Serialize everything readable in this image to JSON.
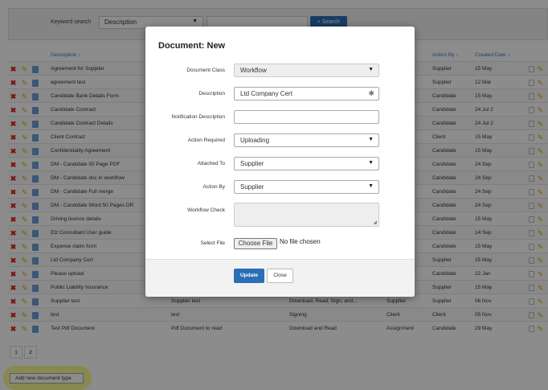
{
  "search": {
    "label": "Keyword search",
    "field_value": "Description",
    "button_label": "Search",
    "button_icon": "search-icon"
  },
  "table": {
    "headers": {
      "description": "Description ↕",
      "action_by": "Action By ↕",
      "created_date": "Created Date ↕"
    },
    "rows": [
      {
        "description": "Agreement for Supplier",
        "action_by": "Supplier",
        "created": "15 May"
      },
      {
        "description": "agreement test",
        "action_by": "Supplier",
        "created": "12 Mar"
      },
      {
        "description": "Candidate Bank Details Form",
        "action_by": "Candidate",
        "created": "15 May"
      },
      {
        "description": "Candidate Contract",
        "action_by": "Candidate",
        "created": "24 Jul 2"
      },
      {
        "description": "Candidate Contract Details",
        "action_by": "Candidate",
        "created": "24 Jul 2"
      },
      {
        "description": "Client Contract",
        "action_by": "Client",
        "created": "15 May"
      },
      {
        "description": "Confidentiality Agreement",
        "action_by": "Candidate",
        "created": "15 May"
      },
      {
        "description": "DM - Candidate 50 Page PDF",
        "action_by": "Candidate",
        "created": "24 Sep"
      },
      {
        "description": "DM - Candidate doc in workflow",
        "action_by": "Candidate",
        "created": "24 Sep"
      },
      {
        "description": "DM - Candidate Full merge",
        "action_by": "Candidate",
        "created": "24 Sep"
      },
      {
        "description": "DM - Candidate Word 50 Pages DR",
        "action_by": "Candidate",
        "created": "24 Sep"
      },
      {
        "description": "Driving licence details",
        "action_by": "Candidate",
        "created": "15 May"
      },
      {
        "description": "Etz Consultant User guide",
        "action_by": "Candidate",
        "created": "14 Sep"
      },
      {
        "description": "Expense claim form",
        "action_by": "Candidate",
        "created": "15 May"
      },
      {
        "description": "Ltd Company Cert",
        "action_by": "Supplier",
        "created": "15 May"
      },
      {
        "description": "Please upload",
        "action_by": "Candidate",
        "created": "22 Jan"
      },
      {
        "description": "Public Liability Insurance",
        "action_by": "Supplier",
        "created": "15 May"
      },
      {
        "description": "Supplier test",
        "col2": "Supplier test",
        "col3": "Download, Read, Sign, and...",
        "col4": "Supplier",
        "action_by": "Supplier",
        "created": "06 Nov"
      },
      {
        "description": "test",
        "col2": "test",
        "col3": "Signing",
        "col4": "Client",
        "action_by": "Client",
        "created": "05 Nov"
      },
      {
        "description": "Test Pdf Document",
        "col2": "Pdf Document to read",
        "col3": "Download and Read",
        "col4": "Assignment",
        "action_by": "Candidate",
        "created": "29 May"
      }
    ]
  },
  "pager": {
    "pages": [
      "1",
      "2"
    ],
    "current": "2"
  },
  "add_button": "Add new document type",
  "modal": {
    "title": "Document: New",
    "fields": {
      "document_class": {
        "label": "Document Class",
        "value": "Workflow"
      },
      "description": {
        "label": "Description",
        "value": "Ltd Company Cert"
      },
      "notification_description": {
        "label": "Notification Description",
        "value": ""
      },
      "action_required": {
        "label": "Action Required",
        "value": "Uploading"
      },
      "attached_to": {
        "label": "Attached To",
        "value": "Supplier"
      },
      "action_by": {
        "label": "Action By",
        "value": "Supplier"
      },
      "workflow_check": {
        "label": "Workflow Check"
      },
      "select_file": {
        "label": "Select File",
        "button": "Choose File",
        "status": "No file chosen"
      }
    },
    "update_label": "Update",
    "close_label": "Close"
  },
  "colors": {
    "primary": "#2a6fb6",
    "delete": "#d9261c",
    "edit": "#e0a300",
    "highlight": "#f0f03c"
  }
}
